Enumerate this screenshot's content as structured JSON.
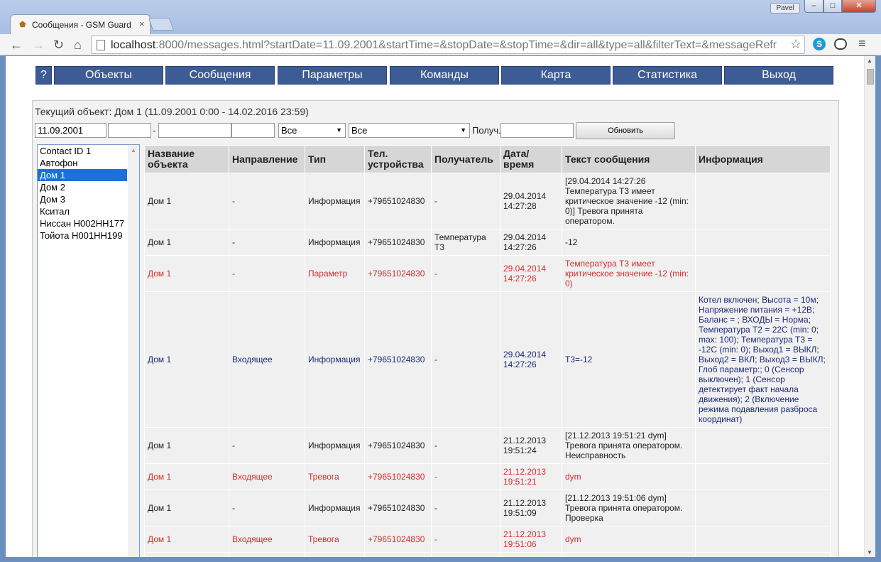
{
  "browser": {
    "tab_title": "Сообщения - GSM Guard",
    "user_badge": "Pavel",
    "url_host": "localhost",
    "url_rest": ":8000/messages.html?startDate=11.09.2001&startTime=&stopDate=&stopTime=&dir=all&type=all&filterText=&messageRefr",
    "icons": [
      "back-icon",
      "forward-icon",
      "reload-icon",
      "home-icon",
      "star-icon",
      "skype-icon",
      "extension-icon",
      "menu-icon"
    ]
  },
  "nav": {
    "help": "?",
    "items": [
      "Объекты",
      "Сообщения",
      "Параметры",
      "Команды",
      "Карта",
      "Статистика",
      "Выход"
    ]
  },
  "current_object": "Текущий объект: Дом 1 (11.09.2001 0:00 - 14.02.2016 23:59)",
  "filters": {
    "start_date": "11.09.2001",
    "start_time": "",
    "dash": "-",
    "stop_date": "",
    "stop_time": "",
    "direction": "Все",
    "type": "Все",
    "recipient_label": "Получ.",
    "recipient": "",
    "refresh_button": "Обновить"
  },
  "objects": [
    "Contact ID 1",
    "Автофон",
    "Дом 1",
    "Дом 2",
    "Дом 3",
    "Кситал",
    "Ниссан Н002НН177",
    "Тойота Н001НН199"
  ],
  "selected_object": "Дом 1",
  "table": {
    "headers": [
      "Название объекта",
      "Направление",
      "Тип",
      "Тел. устройства",
      "Получатель",
      "Дата/ время",
      "Текст сообщения",
      "Информация"
    ],
    "rows": [
      {
        "style": "",
        "cells": [
          "Дом 1",
          "-",
          "Информация",
          "+79651024830",
          "-",
          "29.04.2014 14:27:28",
          "[29.04.2014 14:27:26 Температура Т3 имеет критическое значение -12 (min: 0)] Тревога принята оператором.",
          ""
        ]
      },
      {
        "style": "",
        "cells": [
          "Дом 1",
          "-",
          "Информация",
          "+79651024830",
          "Температура Т3",
          "29.04.2014 14:27:26",
          "-12",
          ""
        ]
      },
      {
        "style": "red",
        "cells": [
          "Дом 1",
          "-",
          "Параметр",
          "+79651024830",
          "-",
          "29.04.2014 14:27:26",
          "Температура Т3 имеет критическое значение -12 (min: 0)",
          ""
        ]
      },
      {
        "style": "blue",
        "cells": [
          "Дом 1",
          "Входящее",
          "Информация",
          "+79651024830",
          "-",
          "29.04.2014 14:27:26",
          "Т3=-12",
          "Котел включен; Высота = 10м; Напряжение питания = +12В; Баланс = ; ВХОДЫ = Норма; Температура Т2 = 22С (min: 0; max: 100); Температура Т3 = -12С (min: 0); Выход1 = ВЫКЛ; Выход2 = ВКЛ; Выход3 = ВЫКЛ; Глоб параметр:; 0 (Сенсор выключен); 1 (Сенсор детектирует факт начала движения); 2 (Включение режима подавления разброса координат)"
        ]
      },
      {
        "style": "",
        "cells": [
          "Дом 1",
          "-",
          "Информация",
          "+79651024830",
          "-",
          "21.12.2013 19:51:24",
          "[21.12.2013 19:51:21 dym] Тревога принята оператором. Неисправность",
          ""
        ]
      },
      {
        "style": "red",
        "cells": [
          "Дом 1",
          "Входящее",
          "Тревога",
          "+79651024830",
          "-",
          "21.12.2013 19:51:21",
          "dym",
          ""
        ]
      },
      {
        "style": "",
        "cells": [
          "Дом 1",
          "-",
          "Информация",
          "+79651024830",
          "-",
          "21.12.2013 19:51:09",
          "[21.12.2013 19:51:06 dym] Тревога принята оператором. Проверка",
          ""
        ]
      },
      {
        "style": "red",
        "cells": [
          "Дом 1",
          "Входящее",
          "Тревога",
          "+79651024830",
          "-",
          "21.12.2013 19:51:06",
          "dym",
          ""
        ]
      },
      {
        "style": "",
        "cells": [
          "",
          "",
          "",
          "",
          "",
          "",
          "",
          ""
        ]
      }
    ]
  }
}
